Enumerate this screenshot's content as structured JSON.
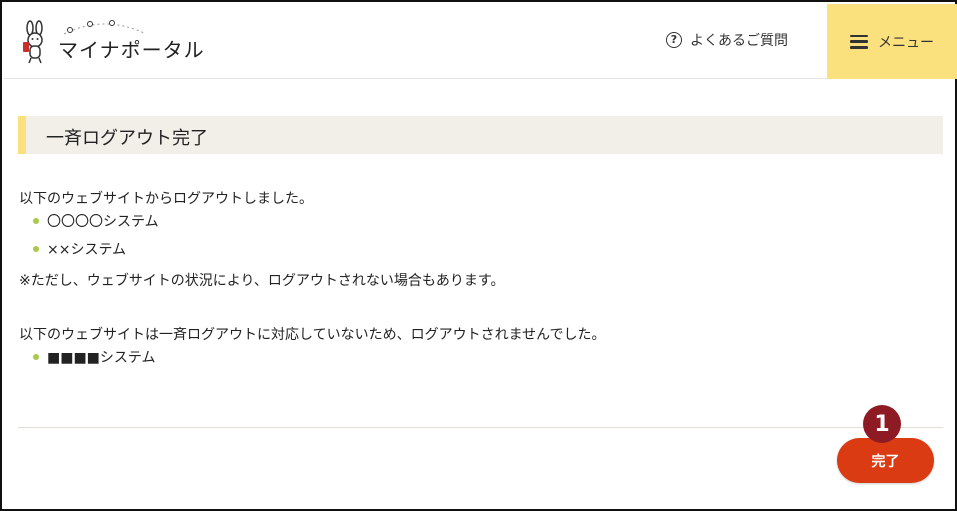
{
  "header": {
    "logo_text": "マイナポータル",
    "faq_label": "よくあるご質問",
    "menu_label": "メニュー"
  },
  "page": {
    "title": "一斉ログアウト完了"
  },
  "logout_success": {
    "intro": "以下のウェブサイトからログアウトしました。",
    "items": [
      "〇〇〇〇システム",
      "××システム"
    ],
    "note": "※ただし、ウェブサイトの状況により、ログアウトされない場合もあります。"
  },
  "logout_unsupported": {
    "intro": "以下のウェブサイトは一斉ログアウトに対応していないため、ログアウトされませんでした。",
    "items": [
      "■■■■システム"
    ]
  },
  "actions": {
    "done_label": "完了",
    "step_number": "1"
  },
  "colors": {
    "menu_bg": "#fbe17d",
    "title_accent": "#fbe17d",
    "title_bg": "#f1efe8",
    "bullet": "#a9c94a",
    "done_button": "#db3b12",
    "step_badge": "#8e1b24"
  }
}
